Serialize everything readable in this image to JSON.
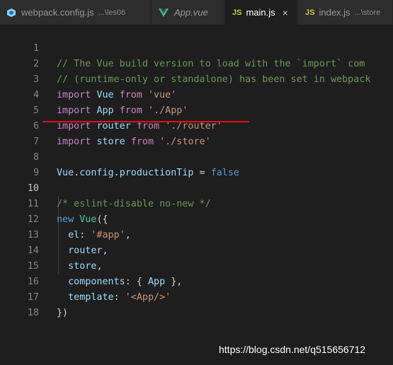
{
  "tabs": [
    {
      "name": "webpack.config.js",
      "desc": "...\\les06",
      "icon": "webpack-icon",
      "active": false
    },
    {
      "name": "App.vue",
      "desc": "",
      "icon": "vue-icon",
      "active": false
    },
    {
      "name": "main.js",
      "desc": "",
      "icon": "js-icon",
      "active": true,
      "close": "×"
    },
    {
      "name": "index.js",
      "desc": "...\\store",
      "icon": "js-icon",
      "active": false
    }
  ],
  "js_label": "JS",
  "line_numbers": [
    "1",
    "2",
    "3",
    "4",
    "5",
    "6",
    "7",
    "8",
    "9",
    "10",
    "11",
    "12",
    "13",
    "14",
    "15",
    "16",
    "17",
    "18"
  ],
  "code": {
    "l1": "// The Vue build version to load with the `import` com",
    "l2": "// (runtime-only or standalone) has been set in webpack",
    "l3": {
      "kw": "import",
      "id": "Vue",
      "from": "from",
      "str": "'vue'"
    },
    "l4": {
      "kw": "import",
      "id": "App",
      "from": "from",
      "str": "'./App'"
    },
    "l5": {
      "kw": "import",
      "id": "router",
      "from": "from",
      "str": "'./router'"
    },
    "l6": {
      "kw": "import",
      "id": "store",
      "from": "from",
      "str": "'./store'"
    },
    "l8": {
      "obj": "Vue",
      "dot1": ".",
      "prop1": "config",
      "dot2": ".",
      "prop2": "productionTip",
      "eq": " = ",
      "val": "false"
    },
    "l10": "/* eslint-disable no-new */",
    "l11": {
      "kw": "new",
      "cls": "Vue",
      "pn": "({"
    },
    "l12": {
      "key": "el",
      "colon": ": ",
      "str": "'#app'",
      "comma": ","
    },
    "l13": {
      "val": "router",
      "comma": ","
    },
    "l14": {
      "val": "store",
      "comma": ","
    },
    "l15": {
      "key": "components",
      "colon": ": ",
      "open": "{ ",
      "val": "App",
      "close": " },"
    },
    "l16": {
      "key": "template",
      "colon": ": ",
      "str": "'<App/>'"
    },
    "l17": "})"
  },
  "watermark": "https://blog.csdn.net/q515656712",
  "colors": {
    "keyword": "#c586c0",
    "comment": "#6a9955",
    "string": "#ce9178",
    "variable": "#9cdcfe",
    "class": "#4ec9b0",
    "underline": "#e01010"
  }
}
